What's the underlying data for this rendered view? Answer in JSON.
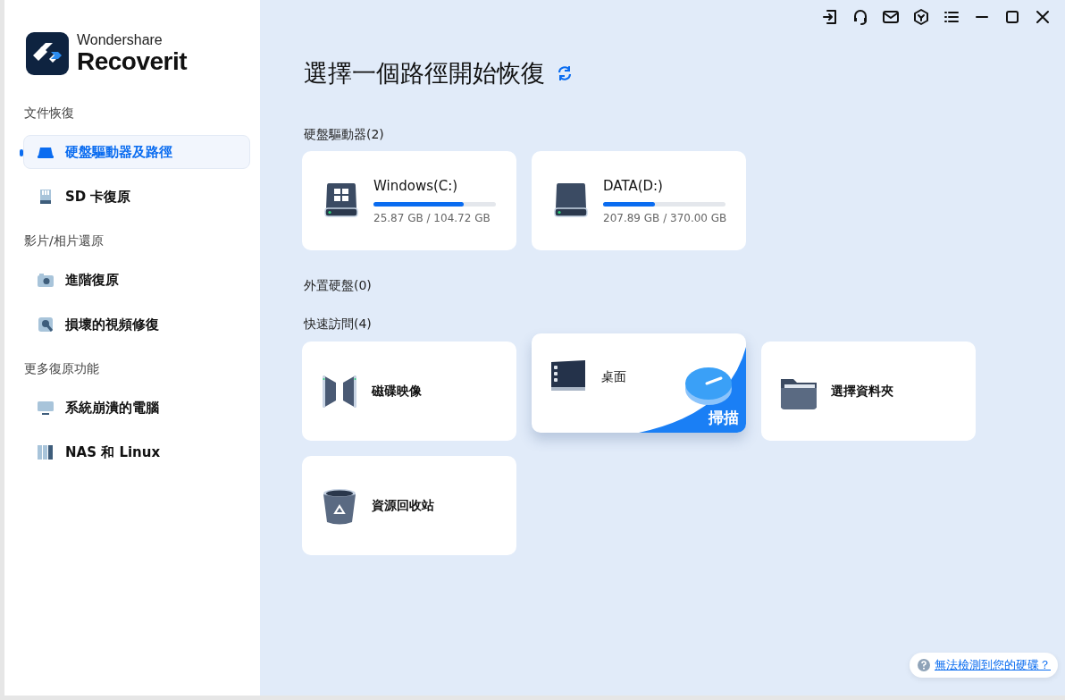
{
  "brand": {
    "company": "Wondershare",
    "product": "Recoverit"
  },
  "sidebar": [
    {
      "heading": "文件恢復",
      "items": [
        {
          "label": "硬盤驅動器及路徑",
          "kind": "drive",
          "selected": true
        },
        {
          "label": "SD 卡復原",
          "kind": "sd",
          "selected": false
        }
      ]
    },
    {
      "heading": "影片/相片還原",
      "items": [
        {
          "label": "進階復原",
          "kind": "camera",
          "selected": false
        },
        {
          "label": "損壞的視頻修復",
          "kind": "repair",
          "selected": false
        }
      ]
    },
    {
      "heading": "更多復原功能",
      "items": [
        {
          "label": "系統崩潰的電腦",
          "kind": "monitor",
          "selected": false
        },
        {
          "label": "NAS 和 Linux",
          "kind": "nas",
          "selected": false
        }
      ]
    }
  ],
  "title": "選擇一個路徑開始恢復",
  "hard_drives": {
    "heading": "硬盤驅動器(2)",
    "drives": [
      {
        "name": "Windows(C:)",
        "kind": "system",
        "level": 0.74,
        "reading": "25.87 GB / 104.72 GB"
      },
      {
        "name": "DATA(D:)",
        "kind": "data",
        "level": 0.42,
        "reading": "207.89 GB / 370.00 GB"
      }
    ]
  },
  "external_drives": {
    "heading": "外置硬盤(0)"
  },
  "quick_access": {
    "heading": "快速訪問(4)",
    "items": [
      {
        "label": "磁碟映像",
        "kind": "image",
        "hovered": false
      },
      {
        "label": "桌面",
        "kind": "desktop",
        "hovered": true,
        "action": "掃描"
      },
      {
        "label": "選擇資料夾",
        "kind": "folder",
        "hovered": false
      },
      {
        "label": "資源回收站",
        "kind": "bin",
        "hovered": false
      }
    ]
  },
  "help_link": "無法檢測到您的硬碟？"
}
